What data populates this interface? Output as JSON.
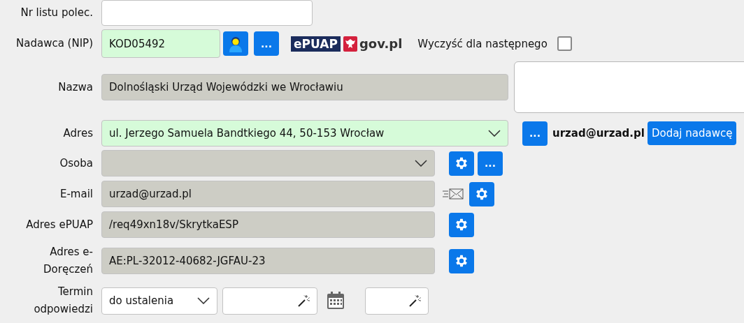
{
  "registered_letter": {
    "label": "Nr listu polec."
  },
  "sender": {
    "label": "Nadawca (NIP)",
    "value": "KOD05492",
    "verified": true,
    "more_button": "...",
    "epuap_logo": "ePUAP",
    "gov_logo": "gov.pl"
  },
  "clear_for_next": {
    "label": "Wyczyść dla następnego",
    "checked": false
  },
  "name": {
    "label": "Nazwa",
    "value": "Dolnośląski Urząd Wojewódzki we Wrocławiu",
    "readonly": true
  },
  "address": {
    "label": "Adres",
    "value": "ul. Jerzego Samuela Bandtkiego 44, 50-153 Wrocław",
    "verified": true,
    "more_button": "...",
    "email": "urzad@urzad.pl",
    "add_button": "Dodaj nadawcę"
  },
  "person": {
    "label": "Osoba",
    "readonly": true,
    "more_button": "..."
  },
  "contacts": [
    {
      "kind": "email",
      "label": "E-mail",
      "value": "urzad@urzad.pl",
      "readonly": true
    },
    {
      "kind": "plain",
      "label": "Adres ePUAP",
      "value": "/req49xn18v/SkrytkaESP",
      "readonly": true
    },
    {
      "kind": "plain",
      "label": "Adres e-Doręczeń",
      "value": "AE:PL-32012-40682-JGFAU-23",
      "readonly": true
    }
  ],
  "deadline": {
    "label": "Termin odpowiedzi",
    "mode": "do ustalenia"
  }
}
